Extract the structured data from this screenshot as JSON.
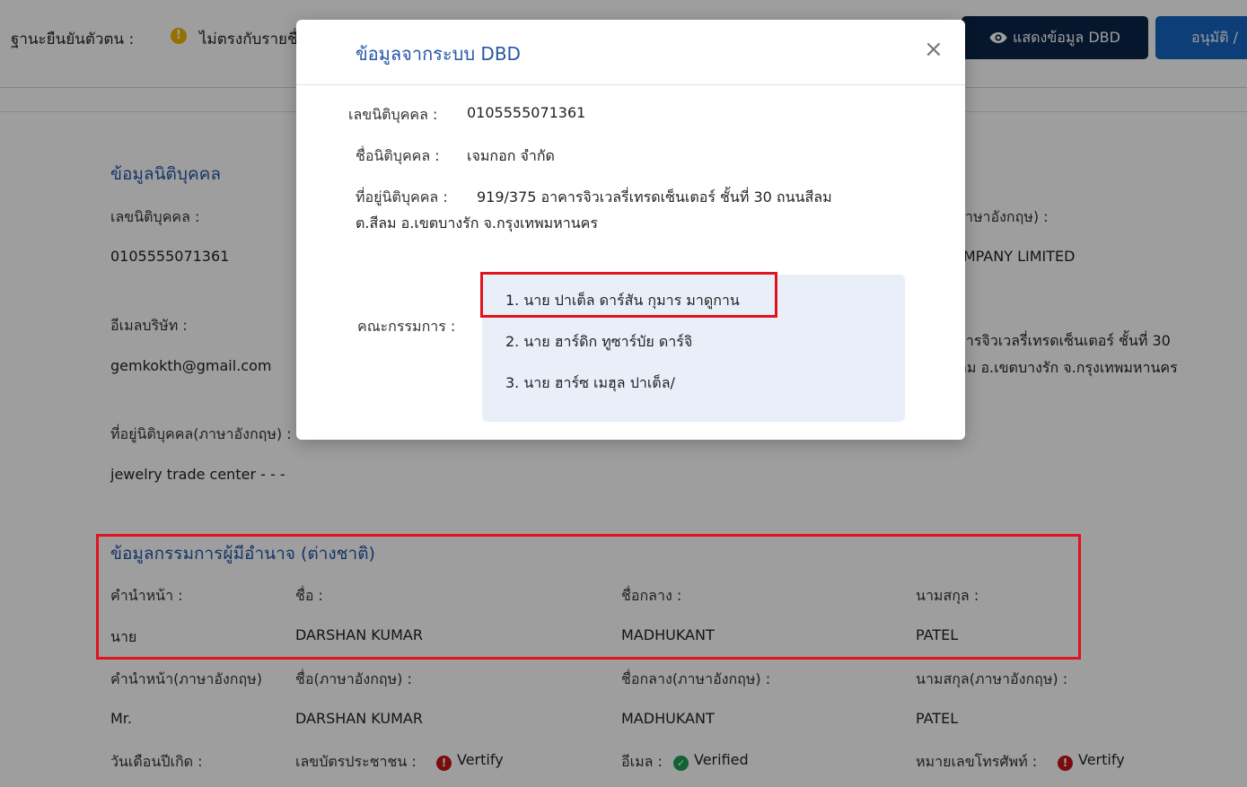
{
  "header": {
    "status_label": "ฐานะยืนยันตัวตน :",
    "status_value": "ไม่ตรงกับรายชื่อ",
    "status_icon": "warning-icon",
    "show_dbd_button": "แสดงข้อมูล DBD",
    "approve_button": "อนุมัติ /"
  },
  "juristic": {
    "title": "ข้อมูลนิติบุคคล",
    "reg_no_label": "เลขนิติบุคคล :",
    "reg_no_value": "0105555071361",
    "name_en_label": "ชื่อนิติบุคคล(ภาษาอังกฤษ) :",
    "name_en_value": "GEMKOK COMPANY LIMITED",
    "email_label": "อีเมลบริษัท :",
    "email_value": "gemkokth@gmail.com",
    "address_line1": "919/375 อาคารจิวเวลรี่เทรดเซ็นเตอร์ ชั้นที่ 30",
    "address_line2": "ถนนสีลม ต.สีลม อ.เขตบางรัก จ.กรุงเทพมหานคร",
    "address_en_label": "ที่อยู่นิติบุคคล(ภาษาอังกฤษ) :",
    "address_en_value": "jewelry trade center - - -"
  },
  "directors": {
    "title": "ข้อมูลกรรมการผู้มีอำนาจ (ต่างชาติ)",
    "prefix_label": "คำนำหน้า :",
    "first_label": "ชื่อ :",
    "middle_label": "ชื่อกลาง :",
    "last_label": "นามสกุล :",
    "prefix_value": "นาย",
    "first_value": "DARSHAN KUMAR",
    "middle_value": "MADHUKANT",
    "last_value": "PATEL",
    "prefix_en_label": "คำนำหน้า(ภาษาอังกฤษ)",
    "first_en_label": "ชื่อ(ภาษาอังกฤษ) :",
    "middle_en_label": "ชื่อกลาง(ภาษาอังกฤษ) :",
    "last_en_label": "นามสกุล(ภาษาอังกฤษ) :",
    "prefix_en_value": "Mr.",
    "first_en_value": "DARSHAN KUMAR",
    "middle_en_value": "MADHUKANT",
    "last_en_value": "PATEL",
    "dob_label": "วันเดือนปีเกิด :",
    "id_card_label": "เลขบัตรประชาชน :",
    "id_card_status": "Vertify",
    "email_label": "อีเมล :",
    "email_status": "Verified",
    "phone_label": "หมายเลขโทรศัพท์ :",
    "phone_status": "Vertify"
  },
  "modal": {
    "title": "ข้อมูลจากระบบ DBD",
    "close_glyph": "×",
    "reg_no_label": "เลขนิติบุคคล :",
    "reg_no_value": "0105555071361",
    "name_label": "ชื่อนิติบุคคล :",
    "name_value": "เจมกอก จำกัด",
    "address_label": "ที่อยู่นิติบุคคล :",
    "address_line1": "919/375 อาคารจิวเวลรี่เทรดเซ็นเตอร์ ชั้นที่ 30 ถนนสีลม",
    "address_line2": "ต.สีลม อ.เขตบางรัก จ.กรุงเทพมหานคร",
    "board_label": "คณะกรรมการ :",
    "board_members": [
      "1. นาย ปาเต็ล ดาร์สัน กุมาร มาดูกาน",
      "2. นาย ฮาร์ดิก ทูซาร์บัย ดาร์จิ",
      "3. นาย ฮาร์ซ เมฮุล ปาเต็ล/"
    ]
  },
  "colors": {
    "accent": "#2456a6",
    "dark_button": "#0b2447",
    "primary_button": "#1565c0",
    "highlight_box": "#e0141e",
    "error": "#c51414",
    "success": "#1f9d55",
    "warning": "#f0b400"
  }
}
